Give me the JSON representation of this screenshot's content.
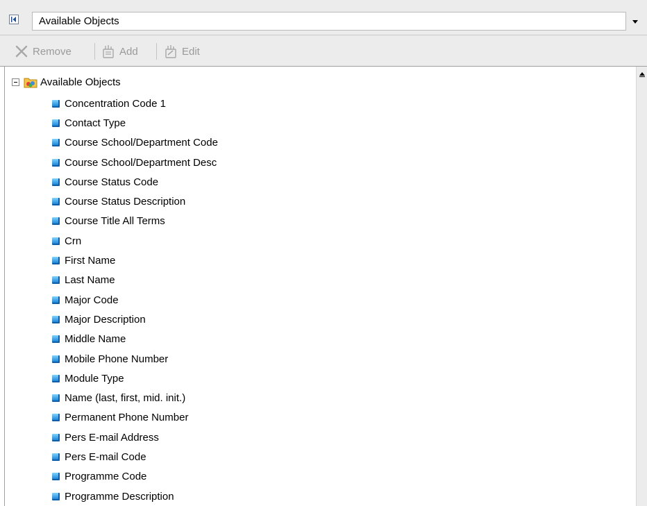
{
  "selector": {
    "value": "Available Objects"
  },
  "toolbar": {
    "remove_label": "Remove",
    "add_label": "Add",
    "edit_label": "Edit"
  },
  "tree": {
    "root_label": "Available Objects",
    "items": [
      "Concentration Code 1",
      "Contact Type",
      "Course School/Department Code",
      "Course School/Department Desc",
      "Course Status Code",
      "Course Status Description",
      "Course Title All Terms",
      "Crn",
      "First Name",
      "Last Name",
      "Major Code",
      "Major Description",
      "Middle Name",
      "Mobile Phone Number",
      "Module Type",
      "Name (last, first, mid. init.)",
      "Permanent Phone Number",
      "Pers E-mail Address",
      "Pers E-mail Code",
      "Programme Code",
      "Programme Description"
    ]
  },
  "icons": {
    "collapse": "collapse-panel-icon",
    "dropdown": "chevron-down-icon",
    "remove": "remove-x-icon",
    "add": "add-icon",
    "edit": "edit-icon",
    "folder": "universe-folder-icon",
    "dimension": "dimension-object-icon",
    "scroll_up": "scroll-up-arrow-icon"
  },
  "colors": {
    "toolbar_bg": "#ececec",
    "dimension_icon": "#1d86d8",
    "disabled_text": "#9a9a9a"
  }
}
